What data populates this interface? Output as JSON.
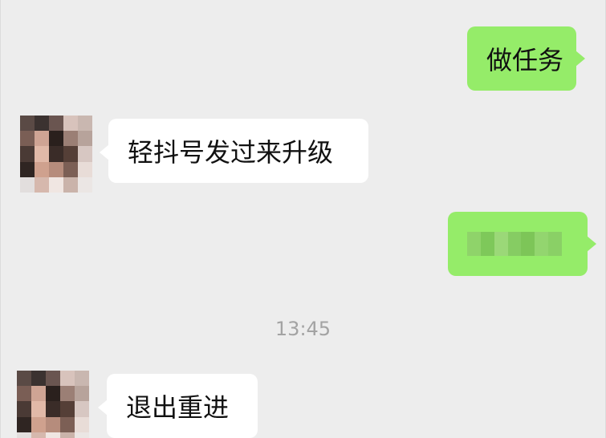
{
  "messages": [
    {
      "sender": "me",
      "text": "做任务"
    },
    {
      "sender": "them",
      "text": "轻抖号发过来升级"
    },
    {
      "sender": "me",
      "text": ""
    },
    {
      "sender": "them",
      "text": "退出重进"
    }
  ],
  "timestamp": "13:45",
  "colors": {
    "background": "#ededed",
    "outgoing_bubble": "#95ec69",
    "incoming_bubble": "#ffffff",
    "timestamp_text": "#a3a3a3"
  }
}
